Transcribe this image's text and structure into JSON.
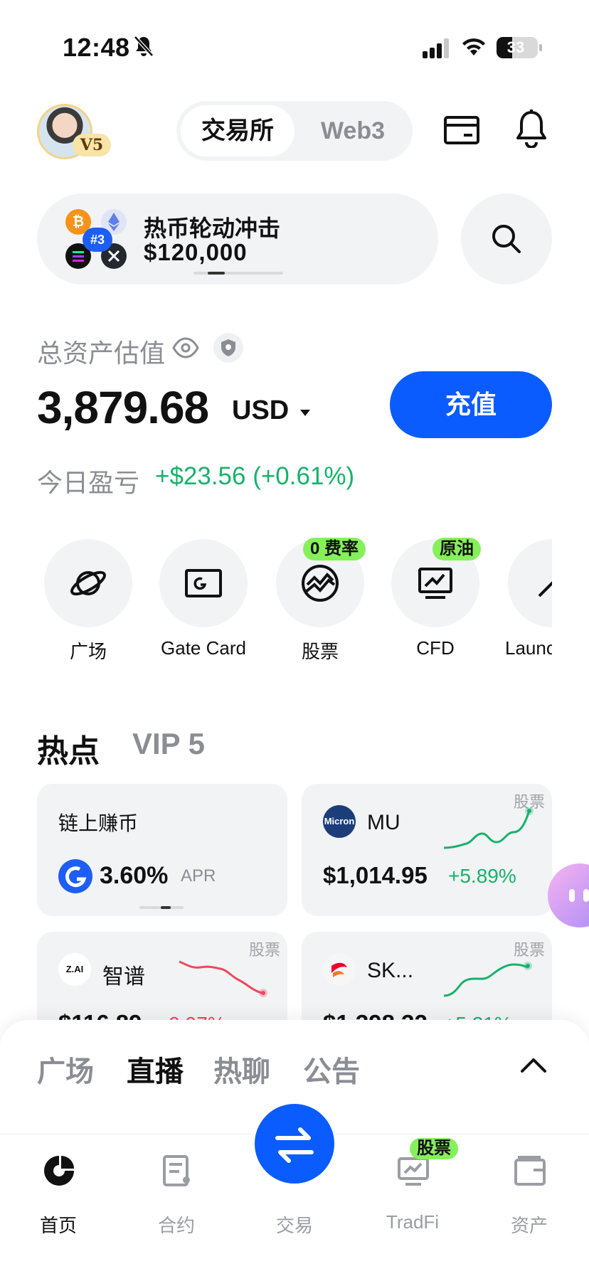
{
  "status_bar": {
    "time": "12:48",
    "battery": "33"
  },
  "header": {
    "vip_badge": "V5",
    "tabs": [
      {
        "label": "交易所",
        "active": true
      },
      {
        "label": "Web3",
        "active": false
      }
    ]
  },
  "promo": {
    "title": "热币轮动冲击",
    "amount": "$120,000",
    "rank_badge": "#3"
  },
  "assets": {
    "label": "总资产估值",
    "total": "3,879.68",
    "currency": "USD",
    "deposit_label": "充值",
    "pnl_label": "今日盈亏",
    "pnl_value": "+$23.56 (+0.61%)"
  },
  "quick_actions": [
    {
      "label": "广场",
      "icon": "planet-icon"
    },
    {
      "label": "Gate Card",
      "icon": "card-icon"
    },
    {
      "label": "股票",
      "icon": "globe-chart-icon",
      "badge": "0 费率"
    },
    {
      "label": "CFD",
      "icon": "monitor-chart-icon",
      "badge": "原油"
    },
    {
      "label": "Launc",
      "icon": "launch-icon"
    }
  ],
  "hot": {
    "title": "热点",
    "vip_label": "VIP 5",
    "cards": [
      {
        "title": "链上赚币",
        "rate": "3.60%",
        "rate_suffix": "APR"
      },
      {
        "tag": "股票",
        "ticker": "MU",
        "logo_text": "Micron",
        "price": "$1,014.95",
        "change": "+5.89%",
        "trend": "up"
      },
      {
        "tag": "股票",
        "ticker": "智谱",
        "logo_text": "Z.AI",
        "price": "$116.89",
        "change": "-9.97%",
        "trend": "down"
      },
      {
        "tag": "股票",
        "ticker": "SK...",
        "price": "$1,398.32",
        "change": "+5.21%",
        "trend": "up"
      }
    ]
  },
  "sheet": {
    "tabs": [
      {
        "label": "广场",
        "active": false
      },
      {
        "label": "直播",
        "active": true
      },
      {
        "label": "热聊",
        "active": false
      },
      {
        "label": "公告",
        "active": false
      }
    ]
  },
  "bottom_nav": {
    "items": [
      {
        "label": "首页",
        "active": true
      },
      {
        "label": "合约",
        "active": false
      },
      {
        "label": "交易",
        "active": false
      },
      {
        "label": "TradFi",
        "active": false,
        "badge": "股票"
      },
      {
        "label": "资产",
        "active": false
      }
    ]
  },
  "colors": {
    "accent": "#0b5cff",
    "up": "#17b26a",
    "down": "#f0475c",
    "badge_green": "#86f05b"
  }
}
